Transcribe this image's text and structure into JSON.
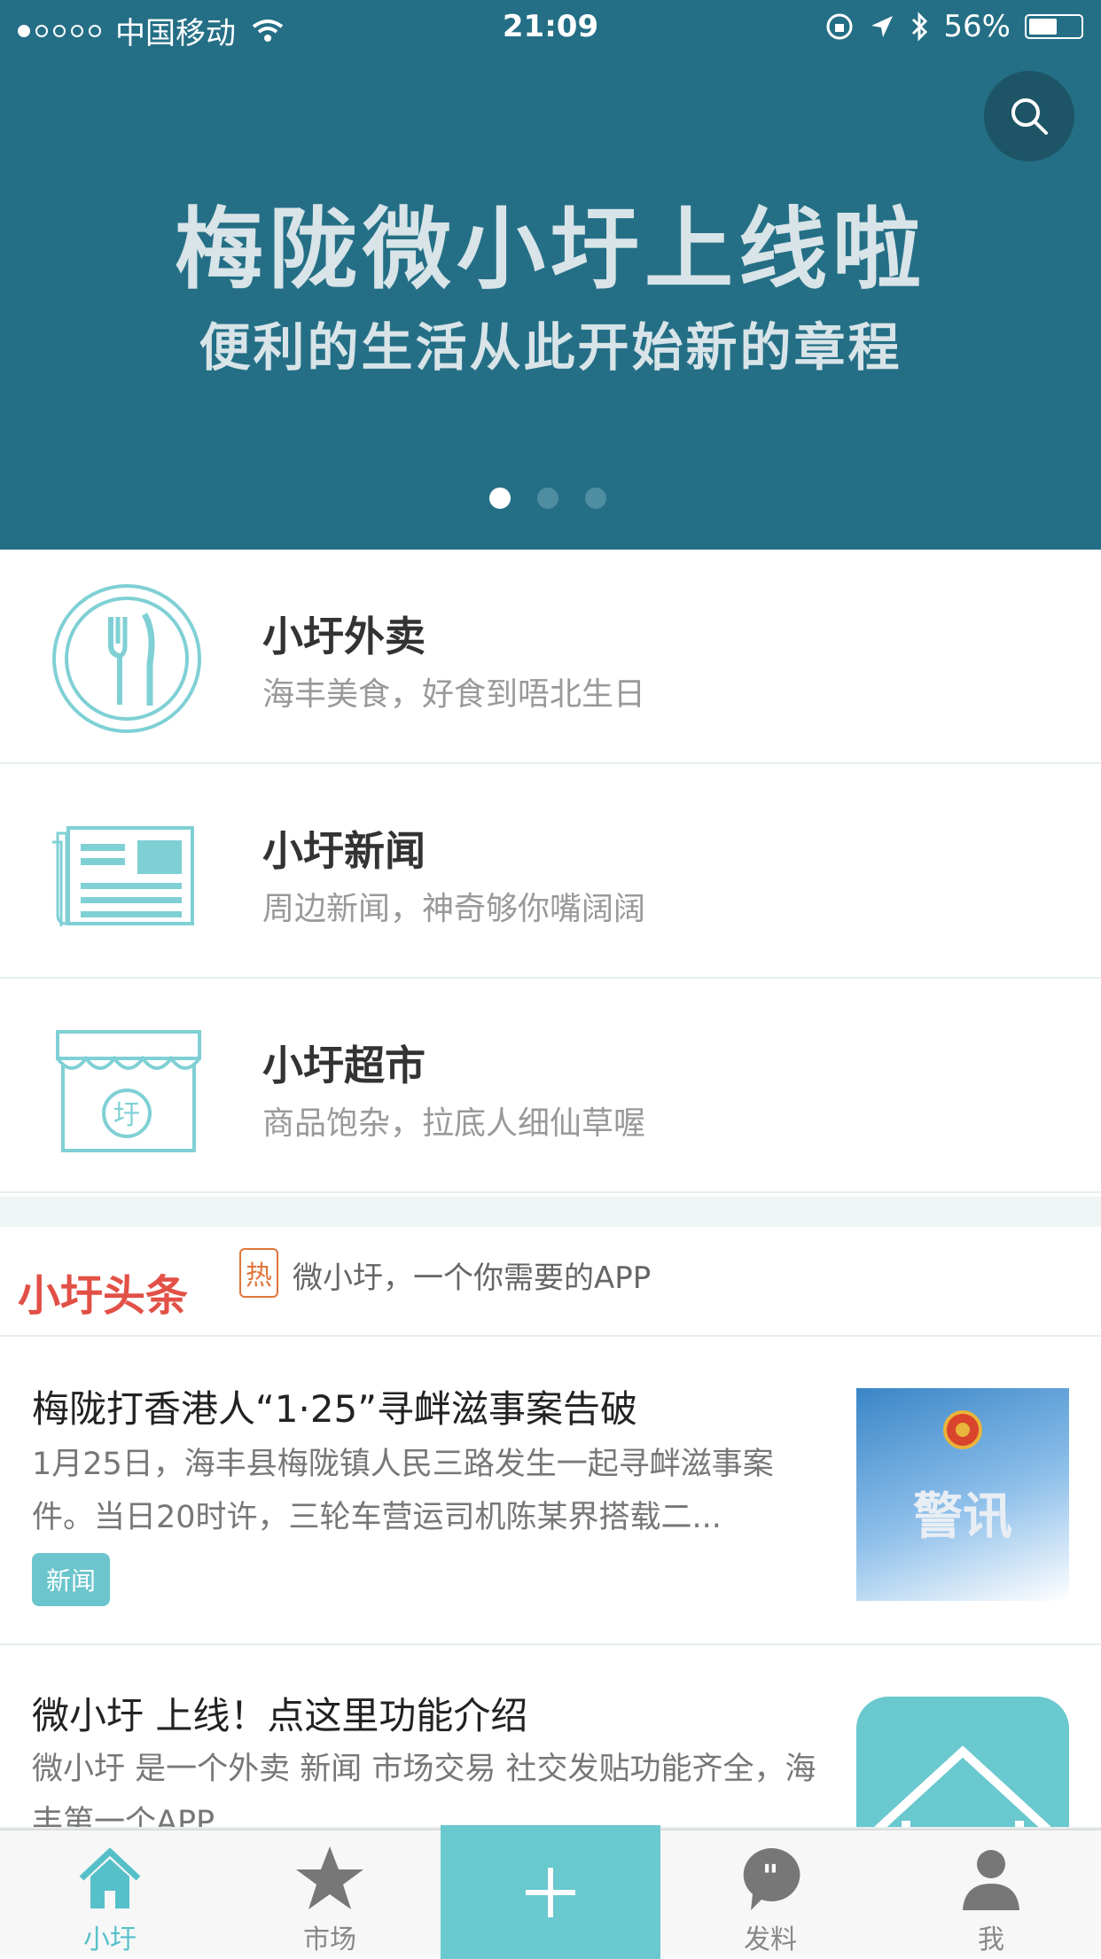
{
  "status_bar": {
    "carrier": "中国移动",
    "time": "21:09",
    "battery": "56%",
    "battery_fraction": 0.56
  },
  "banner": {
    "title": "梅陇微小圩上线啦",
    "subtitle": "便利的生活从此开始新的章程",
    "pages": 3,
    "active_page": 1
  },
  "services": [
    {
      "title": "小圩外卖",
      "desc": "海丰美食，好食到唔北生日",
      "icon": "fork-knife-icon"
    },
    {
      "title": "小圩新闻",
      "desc": "周边新闻，神奇够你嘴阔阔",
      "icon": "newspaper-icon"
    },
    {
      "title": "小圩超市",
      "desc": "商品饱杂，拉底人细仙草喔",
      "icon": "store-icon"
    }
  ],
  "headline": {
    "label": "小圩头条",
    "hot_badge": "热",
    "text": "微小圩，一个你需要的APP"
  },
  "news": [
    {
      "title": "梅陇打香港人“1·25”寻衅滋事案告破",
      "summary": "1月25日，海丰县梅陇镇人民三路发生一起寻衅滋事案件。当日20时许，三轮车营运司机陈某界搭载二...",
      "tag": "新闻",
      "thumb_text": "警讯"
    },
    {
      "title": "微小圩 上线！点这里功能介绍",
      "summary": "微小圩 是一个外卖 新闻 市场交易 社交发贴功能齐全，海丰第一个APP"
    }
  ],
  "tabs": [
    {
      "label": "小圩",
      "icon": "home-icon",
      "active": true
    },
    {
      "label": "市场",
      "icon": "star-icon"
    },
    {
      "label": "",
      "icon": "plus-icon"
    },
    {
      "label": "发料",
      "icon": "chat-bubble-icon"
    },
    {
      "label": "我",
      "icon": "person-icon"
    }
  ],
  "colors": {
    "banner_bg": "#246f86",
    "accent": "#56c0c9",
    "headline_red": "#e25046",
    "hot_orange": "#e0763d"
  }
}
